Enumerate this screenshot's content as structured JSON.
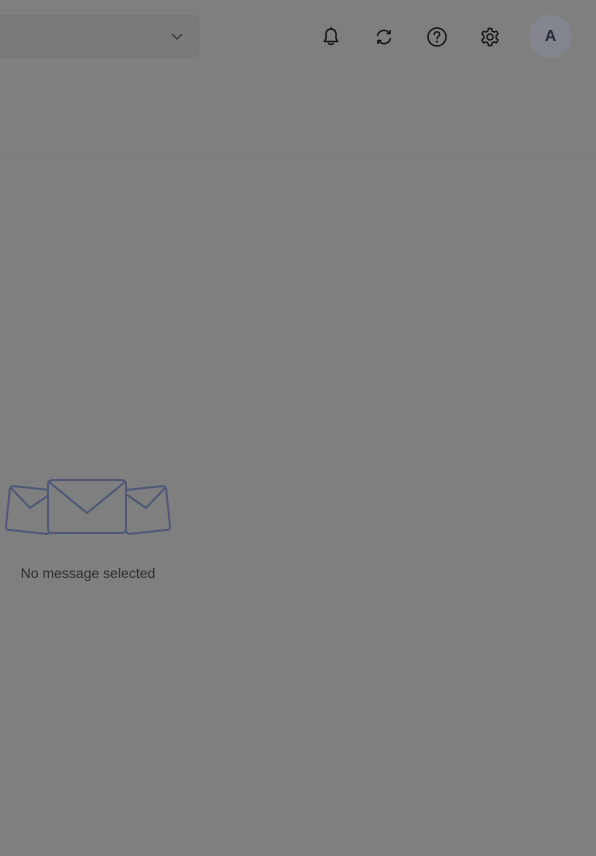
{
  "header": {
    "search_dropdown_value": "",
    "icons": [
      "bell-icon",
      "sync-icon",
      "help-icon",
      "gear-icon",
      "chevron-down-icon",
      "mail-illustration-icon"
    ],
    "avatar_initial": "A"
  },
  "reading_pane": {
    "empty_message": "No message selected"
  },
  "colors": {
    "background": "#7f7f7f",
    "illustration_stroke": "#4f5878",
    "avatar_bg": "#84868f",
    "avatar_text": "#252b3d"
  }
}
